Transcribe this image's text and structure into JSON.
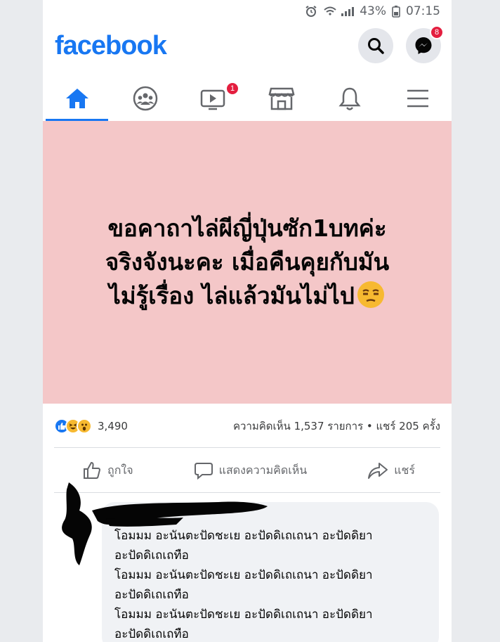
{
  "status_bar": {
    "battery": "43%",
    "time": "07:15"
  },
  "header": {
    "logo": "facebook",
    "messenger_badge": "8"
  },
  "nav": {
    "video_badge": "1"
  },
  "post": {
    "lines": [
      "ขอคาถาไล่ผีญี่ปุ่นซัก1บทค่ะ",
      "จริงจังนะคะ เมื่อคืนคุยกับมัน",
      "ไม่รู้เรื่อง ไล่แล้วมันไม่ไป"
    ],
    "background": "#f4c7c8"
  },
  "stats": {
    "reaction_count": "3,490",
    "comments_shares": "ความคิดเห็น 1,537 รายการ • แชร์ 205 ครั้ง"
  },
  "actions": {
    "like": "ถูกใจ",
    "comment": "แสดงความคิดเห็น",
    "share": "แชร์"
  },
  "comment": {
    "text": "โอมมม อะนันตะปัดชะเย อะปัดดิเถเถนา อะปัดดิยา\nอะปัดดิเถเถทือ\nโอมมม อะนันตะปัดชะเย อะปัดดิเถเถนา อะปัดดิยา\nอะปัดดิเถเถทือ\nโอมมม อะนันตะปัดชะเย อะปัดดิเถเถนา อะปัดดิยา\nอะปัดดิเถเถทือ"
  },
  "colors": {
    "brand": "#1877f2",
    "badge": "#e41e3f"
  }
}
